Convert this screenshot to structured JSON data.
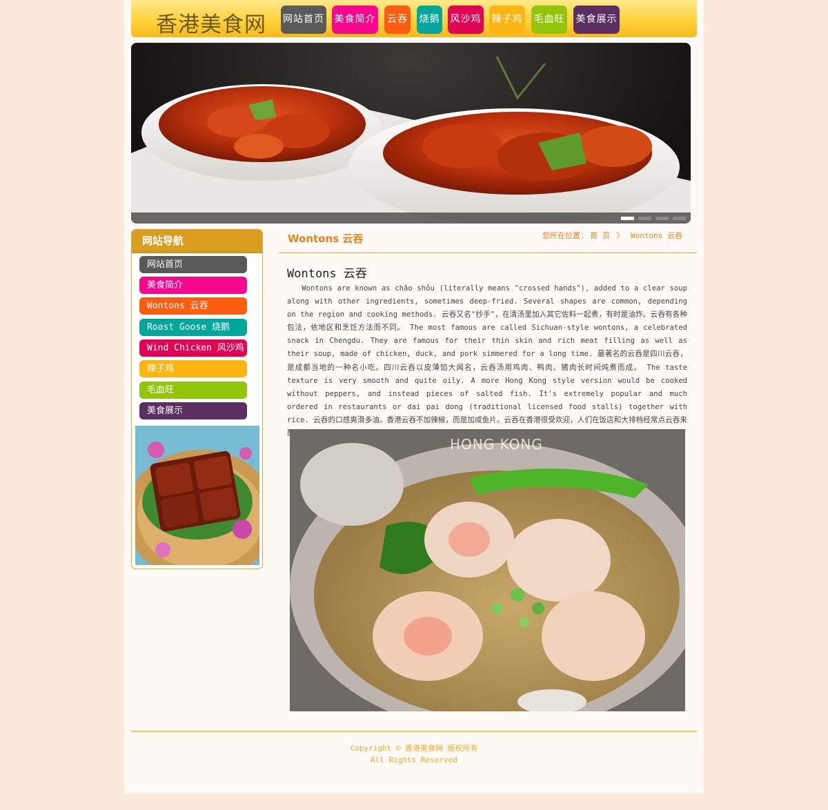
{
  "site": {
    "logo": "香港美食网"
  },
  "nav": [
    {
      "label": "网站首页",
      "color": "#595959"
    },
    {
      "label": "美食简介",
      "color": "#f7078d"
    },
    {
      "label": "云吞",
      "color": "#fd5d11"
    },
    {
      "label": "烧鹅",
      "color": "#02a69b"
    },
    {
      "label": "风沙鸡",
      "color": "#e00554"
    },
    {
      "label": "辣子鸡",
      "color": "#fdb514"
    },
    {
      "label": "毛血旺",
      "color": "#93c50c"
    },
    {
      "label": "美食展示",
      "color": "#5b2f61"
    }
  ],
  "banner": {
    "slides": 4,
    "active_index": 0
  },
  "sidebar": {
    "title": "网站导航",
    "items": [
      {
        "label": "网站首页",
        "color": "#595959"
      },
      {
        "label": "美食简介",
        "color": "#f7078d"
      },
      {
        "label": "Wontons 云吞",
        "color": "#fd5d11"
      },
      {
        "label": "Roast Goose 烧鹅",
        "color": "#02a69b"
      },
      {
        "label": "Wind Chicken 风沙鸡",
        "color": "#e00554"
      },
      {
        "label": "辣子鸡",
        "color": "#fdb514"
      },
      {
        "label": "毛血旺",
        "color": "#93c50c"
      },
      {
        "label": "美食展示",
        "color": "#5b2f61"
      }
    ]
  },
  "content": {
    "section_title": "Wontons 云吞",
    "breadcrumb": {
      "prefix": "您所在位置：",
      "home": "首 页",
      "sep": "〉",
      "current": "Wontons 云吞"
    },
    "article_title": "Wontons 云吞",
    "article_body": "Wontons are known as chāo shǒu (literally means \"crossed hands\"), added to a clear soup along with other ingredients, sometimes deep-fried. Several shapes are common, depending on the region and cooking methods. 云吞又名\"抄手\"，在清汤里加入其它佐料一起煮，有时是油炸。云吞有各种包法，依地区和烹饪方法而不同。 The most famous are called Sichuan-style wontons, a celebrated snack in Chengdu. They are famous for their thin skin and rich meat filling as well as their soup, made of chicken, duck, and pork simmered for a long time. 最著名的云吞是四川云吞，是成都当地的一种名小吃。四川云吞以皮薄馅大闻名，云吞汤用鸡肉、鸭肉、猪肉长时间炖煮而成。 The taste texture is very smooth and quite oily. A more Hong Kong style version would be cooked without peppers, and instead pieces of salted fish. It's extremely popular and much ordered in restaurants or dai pai dong (traditional licensed food stalls) together with rice. 云吞的口感爽滑多油。香港云吞不加辣椒，而是加咸鱼片。云吞在香港很受欢迎，人们在饭店和大排档经常点云吞来配米饭吃。",
    "photo_watermark": "HONG KONG"
  },
  "footer": {
    "line1": "Copyright © 香港美食网 版权所有",
    "line2": "All Rights Reserved"
  }
}
